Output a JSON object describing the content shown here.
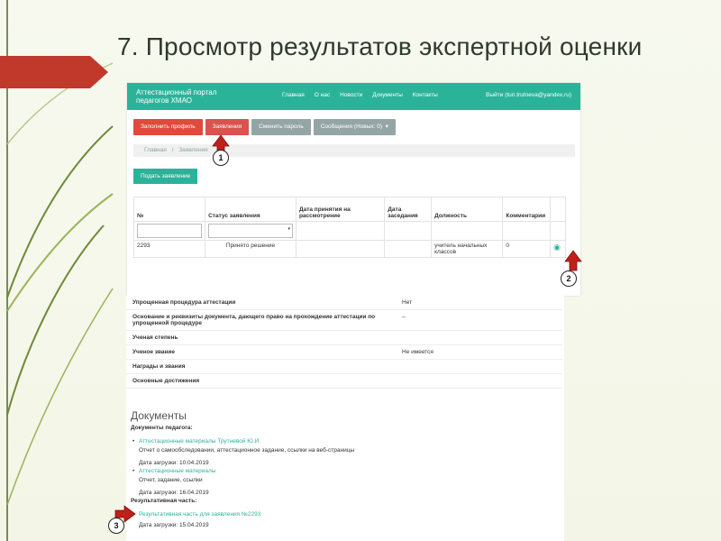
{
  "slide": {
    "title": "7. Просмотр результатов экспертной оценки"
  },
  "portal": {
    "brand": "Аттестационный портал педагогов ХМАО",
    "nav": [
      "Главная",
      "О нас",
      "Новости",
      "Документы",
      "Контакты"
    ],
    "user_link": "Выйти (turi.trutneva@yandex.ru)"
  },
  "toolbar": {
    "fill_profile": "Заполнить профиль",
    "applications": "Заявления",
    "change_password": "Сменить пароль",
    "messages": "Сообщения (Новых: 0)"
  },
  "breadcrumb": {
    "home": "Главная",
    "current": "Заявления"
  },
  "submit_button": "Подать заявление",
  "requests_table": {
    "headers": [
      "№",
      "Статус заявления",
      "Дата принятия на рассмотрение",
      "Дата заседания",
      "Должность",
      "Комментарии"
    ],
    "rows": [
      {
        "num": "2293",
        "status": "Принято решение",
        "accepted": "",
        "meeting": "",
        "position": "учитель начальных классов",
        "comments": "0"
      }
    ]
  },
  "info_rows": [
    {
      "key": "Упрощенная процедура аттестации",
      "value": "Нет"
    },
    {
      "key": "Основание и реквизиты документа, дающего право на прохождение аттестации по упрощенной процедуре",
      "value": "–"
    },
    {
      "key": "Ученая степень",
      "value": ""
    },
    {
      "key": "Ученое звание",
      "value": "Не имеется"
    },
    {
      "key": "Награды и звания",
      "value": ""
    },
    {
      "key": "Основные достижения",
      "value": ""
    }
  ],
  "documents": {
    "title": "Документы",
    "teacher_docs_label": "Документы педагога:",
    "teacher_docs": [
      {
        "link": "Аттестационные материалы Трутневой Ю.И.",
        "desc": "Отчет о самообследовании, аттестационное задание, ссылки на веб-страницы",
        "date": "Дата загрузки: 10.04.2019"
      },
      {
        "link": "Аттестационные материалы",
        "desc": "Отчет, задание, ссылки",
        "date": "Дата загрузки: 16.04.2019"
      }
    ],
    "result_label": "Результативная часть:",
    "result_docs": [
      {
        "link": "Результативная часть для заявления №2293",
        "date": "Дата загрузки: 15.04.2019"
      }
    ]
  },
  "markers": [
    "1",
    "2",
    "3"
  ],
  "colors": {
    "accent": "#2bb39a",
    "danger": "#e04a3b",
    "secondary": "#95a5a6",
    "pointer": "#c0201a"
  }
}
